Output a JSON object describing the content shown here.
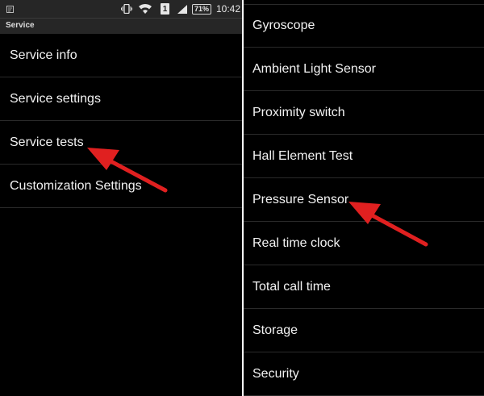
{
  "status_bar": {
    "battery_text": "71%",
    "sim_number": "1",
    "time": "10:42"
  },
  "header": {
    "title": "Service"
  },
  "left_list": [
    "Service info",
    "Service settings",
    "Service tests",
    "Customization Settings"
  ],
  "right_list": [
    "Gyroscope",
    "Ambient Light Sensor",
    "Proximity switch",
    "Hall Element Test",
    "Pressure Sensor",
    "Real time clock",
    "Total call time",
    "Storage",
    "Security"
  ],
  "colors": {
    "background": "#000000",
    "bar": "#262626",
    "divider": "#2a2a2a",
    "text": "#f2f2f2",
    "arrow": "#e02020"
  }
}
